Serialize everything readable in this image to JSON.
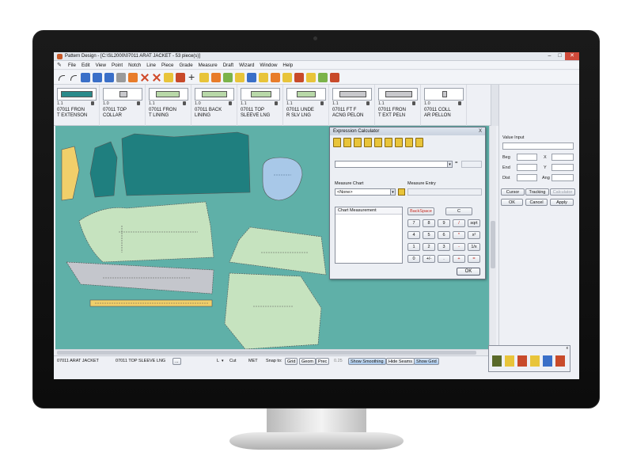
{
  "window": {
    "title": "Pattern Design - [C:\\SL2000\\07011 ARAT JACKET - 53 piece(s)]",
    "controls": [
      "–",
      "□",
      "✕"
    ]
  },
  "menu": {
    "items": [
      "File",
      "Edit",
      "View",
      "Point",
      "Notch",
      "Line",
      "Piece",
      "Grade",
      "Measure",
      "Draft",
      "Wizard",
      "Window",
      "Help"
    ]
  },
  "pieces": [
    {
      "qty": "1.1",
      "name": "07011 FRON\nT EXTENSON"
    },
    {
      "qty": "1.0",
      "name": "07011 TOP\nCOLLAR"
    },
    {
      "qty": "1.1",
      "name": "07011 FRON\nT LINING"
    },
    {
      "qty": "1.0",
      "name": "07011 BACK\nLINING"
    },
    {
      "qty": "1.1",
      "name": "07011 TOP\nSLEEVE LNG"
    },
    {
      "qty": "1.1",
      "name": "07011 UNDE\nR SLV LNG"
    },
    {
      "qty": "1.1",
      "name": "07011 FT F\nACNG PELON"
    },
    {
      "qty": "1.1",
      "name": "07011 FRON\nT EXT PELN"
    },
    {
      "qty": "1.0",
      "name": "07011 COLL\nAR PELLON"
    }
  ],
  "right_panel": {
    "value_input_label": "Value Input",
    "beg_label": "Beg",
    "x_label": "X",
    "end_label": "End",
    "y_label": "Y",
    "dist_label": "Dist",
    "ang_label": "Ang",
    "cursor_btn": "Cursor",
    "tracking_btn": "Tracking",
    "calculator_btn": "Calculator",
    "ok_btn": "OK",
    "cancel_btn": "Cancel",
    "apply_btn": "Apply"
  },
  "calculator": {
    "title": "Expression Calculator",
    "close": "X",
    "eq": "=",
    "measure_chart_label": "Measure Chart",
    "measure_entry_label": "Measure Entry",
    "measure_chart_value": "<None>",
    "list_header": "Chart Measurement",
    "backspace": "BackSpace",
    "clear": "C",
    "keys": [
      [
        "7",
        "8",
        "9",
        "/",
        "sqrt"
      ],
      [
        "4",
        "5",
        "6",
        "*",
        "x²"
      ],
      [
        "1",
        "2",
        "3",
        "-",
        "1/x"
      ],
      [
        "0",
        "+/-",
        ".",
        "+",
        "="
      ]
    ],
    "ok": "OK"
  },
  "status": {
    "piece_left": "07011 ARAT JACKET",
    "piece_right": "07011 TOP SLEEVE LNG",
    "ellipsis": "...",
    "layer": "L",
    "cut": "Cut",
    "units": "MET",
    "snap_label": "Snap to:",
    "grid_btn": "Grid",
    "geom_btn": "Geom",
    "prec_btn": "Prec",
    "snap_value": "0.25",
    "show_smoothing": "Show Smoothing",
    "hide_seams": "Hide Seams",
    "show_grid": "Show Grid"
  },
  "colors": {
    "workspace": "#5fb0a8",
    "piece_green": "#c6e3bf",
    "piece_teal": "#1f7f7f",
    "piece_yellow": "#f1cf6a",
    "piece_blue": "#a8c8e8",
    "piece_gray": "#c4c6cc"
  }
}
